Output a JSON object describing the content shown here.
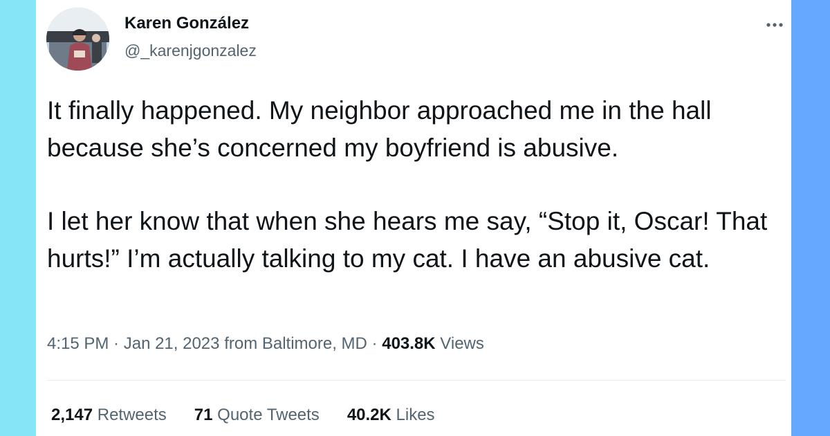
{
  "author": {
    "display_name": "Karen González",
    "handle": "@_karenjgonzalez"
  },
  "tweet": {
    "paragraphs": [
      "It finally happened. My neighbor approached me in the hall because she’s concerned my boyfriend is abusive.",
      "I let her know that when she hears me say, “Stop it, Oscar! That hurts!” I’m actually talking to my cat. I have an abusive cat."
    ]
  },
  "meta": {
    "time": "4:15 PM",
    "separator": " · ",
    "date": "Jan 21, 2023",
    "location": "from Baltimore, MD",
    "views_count": "403.8K",
    "views_label": "Views"
  },
  "stats": {
    "retweets_count": "2,147",
    "retweets_label": "Retweets",
    "quotes_count": "71",
    "quotes_label": "Quote Tweets",
    "likes_count": "40.2K",
    "likes_label": "Likes"
  },
  "icons": {
    "more": "more-options-icon"
  },
  "colors": {
    "left_border": "#84e6f7",
    "right_border": "#64a8ff",
    "text_primary": "#0f1419",
    "text_secondary": "#536471",
    "divider": "#e6ecf0"
  }
}
